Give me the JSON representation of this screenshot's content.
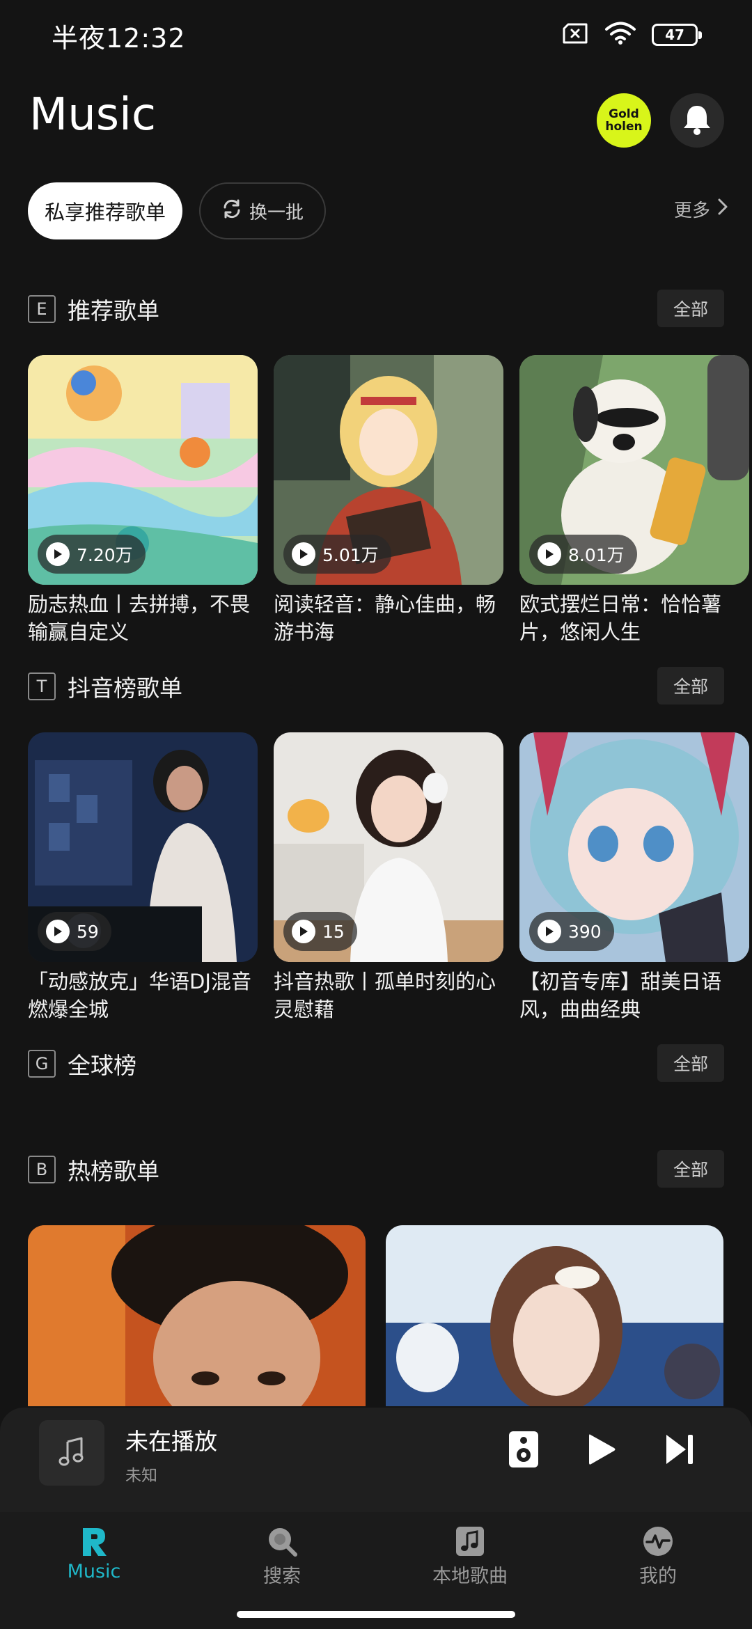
{
  "status": {
    "time": "半夜12:32",
    "battery": "47"
  },
  "header": {
    "title": "Music",
    "badge_line1": "Gold",
    "badge_line2": "holen"
  },
  "pills": {
    "primary": "私享推荐歌单",
    "refresh": "换一批",
    "more": "更多"
  },
  "sections": [
    {
      "letter": "E",
      "title": "推荐歌单",
      "all": "全部",
      "cards": [
        {
          "count": "7.20万",
          "title": "励志热血丨去拼搏，不畏输赢自定义"
        },
        {
          "count": "5.01万",
          "title": "阅读轻音：静心佳曲，畅游书海"
        },
        {
          "count": "8.01万",
          "title": "欧式摆烂日常：恰恰薯片，悠闲人生"
        }
      ]
    },
    {
      "letter": "T",
      "title": "抖音榜歌单",
      "all": "全部",
      "cards": [
        {
          "count": "59",
          "title": "「动感放克」华语DJ混音燃爆全城"
        },
        {
          "count": "15",
          "title": "抖音热歌丨孤单时刻的心灵慰藉"
        },
        {
          "count": "390",
          "title": "【初音专库】甜美日语风，曲曲经典"
        }
      ]
    },
    {
      "letter": "G",
      "title": "全球榜",
      "all": "全部"
    },
    {
      "letter": "B",
      "title": "热榜歌单",
      "all": "全部"
    }
  ],
  "player": {
    "title": "未在播放",
    "subtitle": "未知"
  },
  "nav": [
    {
      "label": "Music",
      "icon": "music-r-logo-icon",
      "active": true
    },
    {
      "label": "搜索",
      "icon": "search-icon"
    },
    {
      "label": "本地歌曲",
      "icon": "music-note-icon"
    },
    {
      "label": "我的",
      "icon": "profile-pulse-icon"
    }
  ],
  "colors": {
    "background": "#141414",
    "accent": "#1fb8c9",
    "badge": "#d8f51a"
  }
}
